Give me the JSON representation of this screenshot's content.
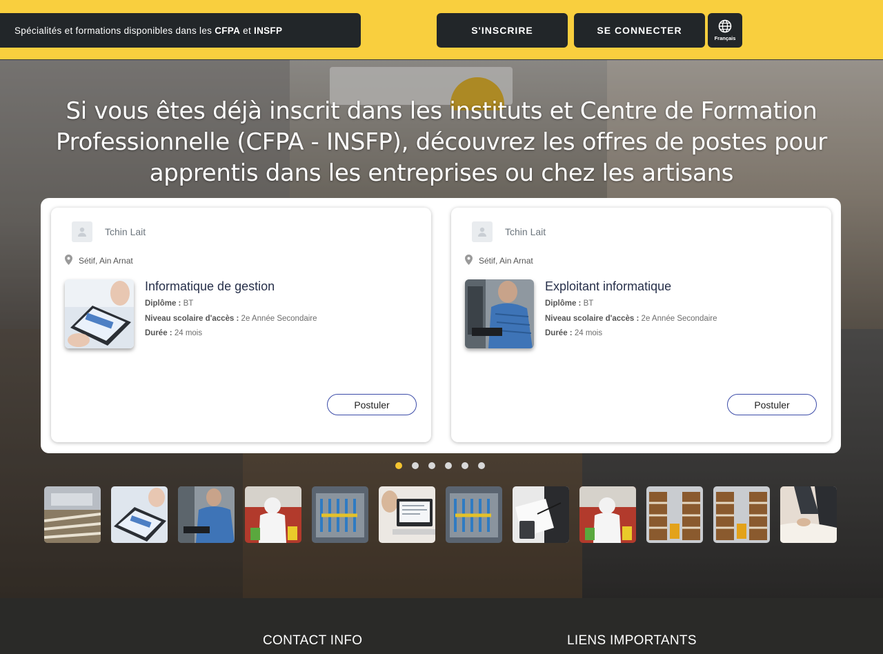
{
  "header": {
    "specialties_prefix": "Spécialités et formations disponibles dans les",
    "specialties_b1": "CFPA",
    "specialties_mid": "et",
    "specialties_b2": "INSFP",
    "signup": "S'INSCRIRE",
    "login": "SE CONNECTER",
    "language": "Français",
    "globe_icon": "globe-icon"
  },
  "hero": {
    "title": "Si vous êtes déjà inscrit dans les instituts et Centre de Formation Professionnelle (CFPA - INSFP), découvrez les offres de postes pour apprentis dans les entreprises ou chez les artisans"
  },
  "cards": [
    {
      "company": "Tchin Lait",
      "location": "Sétif, Ain Arnat",
      "title": "Informatique de gestion",
      "diploma_label": "Diplôme :",
      "diploma": "BT",
      "level_label": "Niveau scolaire d'accès :",
      "level": "2e Année Secondaire",
      "duration_label": "Durée :",
      "duration": "24 mois",
      "apply": "Postuler"
    },
    {
      "company": "Tchin Lait",
      "location": "Sétif, Ain Arnat",
      "title": "Exploitant informatique",
      "diploma_label": "Diplôme :",
      "diploma": "BT",
      "level_label": "Niveau scolaire d'accès :",
      "level": "2e Année Secondaire",
      "duration_label": "Durée :",
      "duration": "24 mois",
      "apply": "Postuler"
    }
  ],
  "carousel": {
    "dot_count": 6,
    "active_index": 0
  },
  "footer": {
    "contact": "CONTACT INFO",
    "links": "LIENS IMPORTANTS"
  },
  "colors": {
    "accent": "#f9cf3e",
    "dark": "#222629",
    "apply_border": "#3b4ba8"
  }
}
